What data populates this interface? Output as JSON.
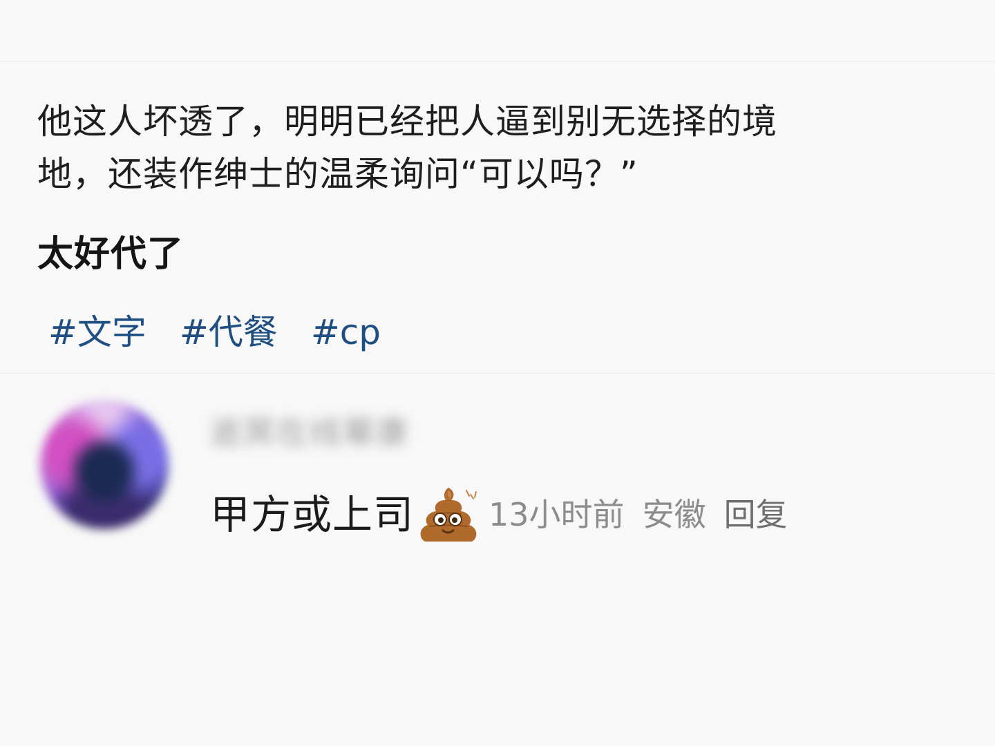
{
  "post": {
    "lines": [
      "他这人坏透了，明明已经把人逼到别无选择的境",
      "地，还装作绅士的温柔询问“可以吗？”"
    ],
    "emphasis": "太好代了",
    "tags": [
      "#文字",
      "#代餐",
      "#cp"
    ]
  },
  "comment": {
    "username": "逝冥在线幂康",
    "text": "甲方或上司",
    "emoji": "poo-icon",
    "time": "13小时前",
    "location": "安徽",
    "reply_label": "回复"
  },
  "colors": {
    "tag": "#1f4f82",
    "text": "#1e1e1e",
    "meta": "#8c8c8c",
    "background": "#f8f8f8"
  }
}
